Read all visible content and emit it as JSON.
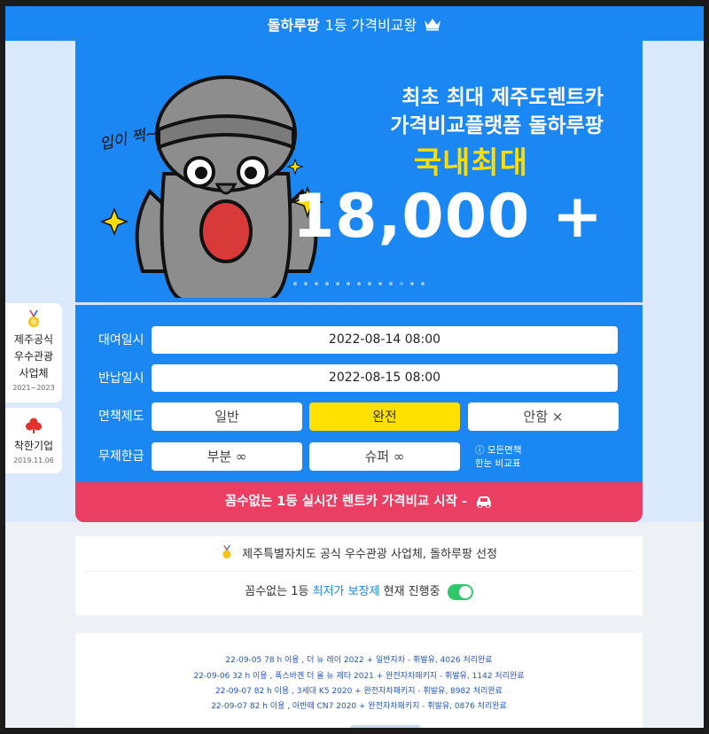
{
  "header": {
    "brand": "돌하루팡",
    "tagline": "1등 가격비교왕"
  },
  "banner": {
    "line1": "최초 최대 제주도렌트카",
    "line2": "가격비교플랫폼 돌하루팡",
    "highlight": "국내최대",
    "big_number": "18,000 +",
    "character_caption": "입이 쩍~",
    "slide_count": 13,
    "active_slide": 10
  },
  "form": {
    "rental_label": "대여일시",
    "rental_value": "2022-08-14 08:00",
    "return_label": "반납일시",
    "return_value": "2022-08-15 08:00",
    "insurance_label": "면책제도",
    "insurance_options": [
      "일반",
      "완전",
      "안함 ×"
    ],
    "insurance_selected": "완전",
    "limit_label": "무제한급",
    "limit_options": [
      "부분 ∞",
      "슈퍼 ∞"
    ],
    "note_line1": "ⓘ 모든면책",
    "note_line2": "한눈 비교표"
  },
  "cta": {
    "label": "꼼수없는 1등 실시간 렌트카 가격비교 시작 -"
  },
  "side": {
    "card1_line1": "제주공식",
    "card1_line2": "우수관광",
    "card1_line3": "사업체",
    "card1_year": "2021~2023",
    "card2_line1": "착한기업",
    "card2_year": "2019.11.06"
  },
  "info": {
    "line1": "제주특별자치도 공식 우수관광 사업체, 돌하루팡 선정",
    "line2_prefix": "꼼수없는 1등",
    "line2_link": "최저가 보장제",
    "line2_suffix": "현재 진행중"
  },
  "log": [
    "22-09-05 78 h 이용 , 더 뉴 레이 2022 + 일반자차 - 휘발유, 4026 처리완료",
    "22-09-06 32 h 이용 , 폭스바겐 더 올 뉴 제타 2021 + 완전자차패키지 - 휘발유, 1142 처리완료",
    "22-09-07 82 h 이용 , 3세대 K5 2020 + 완전자차패키지 - 휘발유, 8982 처리완료",
    "22-09-07 82 h 이용 , 아반떼 CN7 2020 + 완전자차패키지 - 휘발유, 0876 처리완료"
  ],
  "colors": {
    "brand_blue": "#1a87f2",
    "cta_red": "#ea3e62",
    "selected_yellow": "#ffe000",
    "toggle_green": "#2fc76a"
  }
}
